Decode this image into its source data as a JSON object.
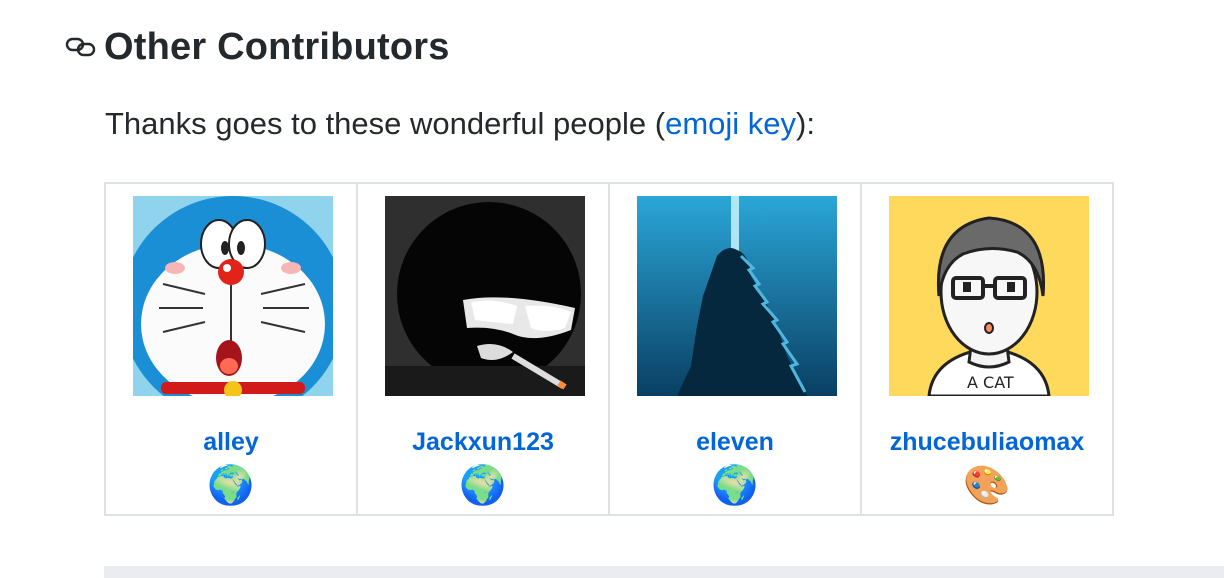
{
  "heading": {
    "title": "Other Contributors",
    "icon": "link-icon"
  },
  "intro": {
    "prefix": "Thanks goes to these wonderful people (",
    "link_text": "emoji key",
    "suffix": "):"
  },
  "contributors": [
    {
      "name": "alley",
      "emoji": "🌍",
      "avatar": "doraemon-avatar"
    },
    {
      "name": "Jackxun123",
      "emoji": "🌍",
      "avatar": "masked-figure-avatar"
    },
    {
      "name": "eleven",
      "emoji": "🌍",
      "avatar": "godzilla-avatar"
    },
    {
      "name": "zhucebuliaomax",
      "emoji": "🎨",
      "avatar": "cartoon-man-avatar"
    }
  ],
  "colors": {
    "link": "#0366d6",
    "border": "#dfe2e5",
    "text": "#24292e"
  }
}
